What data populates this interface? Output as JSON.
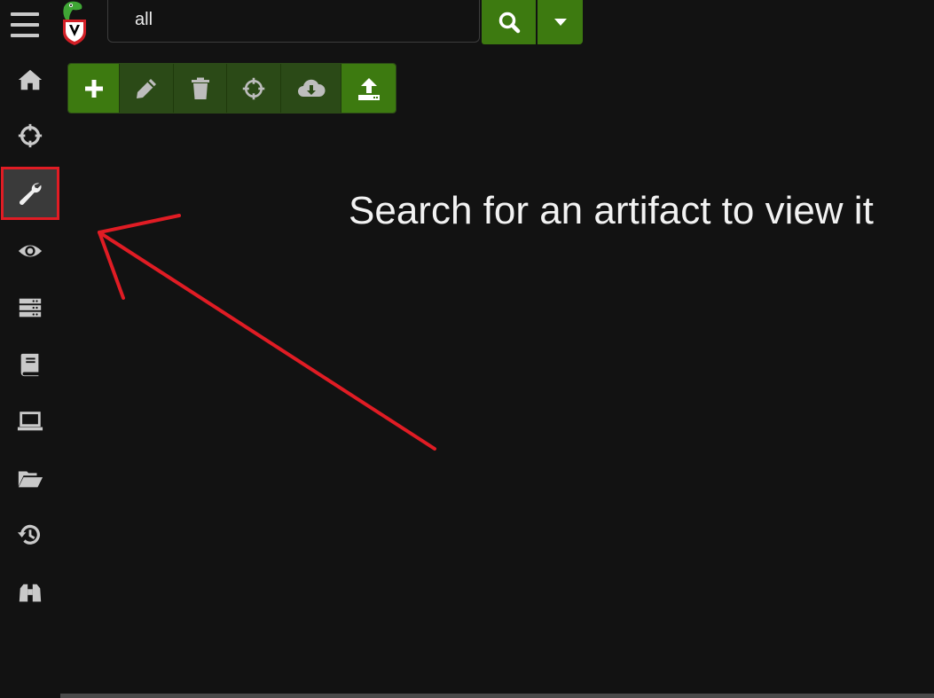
{
  "search": {
    "value": "all"
  },
  "message": "Search for an artifact to view it",
  "colors": {
    "background": "#121212",
    "accent_green": "#3d7a10",
    "disabled_green": "#2b4a17",
    "annotation_red": "#e01c24",
    "icon_gray": "#c9c9c9"
  },
  "sidebar": {
    "items": [
      {
        "icon": "home-icon"
      },
      {
        "icon": "crosshair-icon"
      },
      {
        "icon": "wrench-icon",
        "active": true
      },
      {
        "icon": "eye-icon"
      },
      {
        "icon": "server-icon"
      },
      {
        "icon": "book-icon"
      },
      {
        "icon": "laptop-icon"
      },
      {
        "icon": "folder-open-icon"
      },
      {
        "icon": "history-icon"
      },
      {
        "icon": "binoculars-icon"
      }
    ]
  },
  "toolbar": {
    "buttons": [
      {
        "icon": "plus-icon",
        "enabled": true
      },
      {
        "icon": "pencil-icon",
        "enabled": false
      },
      {
        "icon": "trash-icon",
        "enabled": false
      },
      {
        "icon": "crosshair-icon",
        "enabled": false
      },
      {
        "icon": "cloud-download-icon",
        "enabled": false
      },
      {
        "icon": "upload-icon",
        "enabled": true
      }
    ]
  }
}
